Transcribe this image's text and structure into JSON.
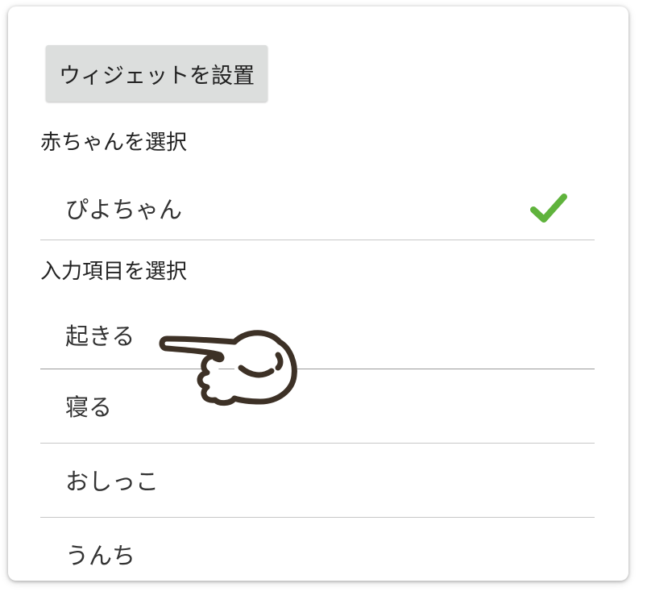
{
  "install_button": {
    "label": "ウィジェットを設置"
  },
  "baby_section": {
    "label": "赤ちゃんを選択",
    "items": [
      {
        "label": "ぴよちゃん",
        "selected": true
      }
    ]
  },
  "input_section": {
    "label": "入力項目を選択",
    "items": [
      {
        "label": "起きる"
      },
      {
        "label": "寝る"
      },
      {
        "label": "おしっこ"
      },
      {
        "label": "うんち"
      }
    ]
  },
  "colors": {
    "check": "#5fb33c",
    "button_bg": "#dcdedd",
    "hand_outline": "#3d3126"
  },
  "icons": {
    "selected": "checkmark-icon",
    "pointer": "pointing-hand-icon"
  }
}
